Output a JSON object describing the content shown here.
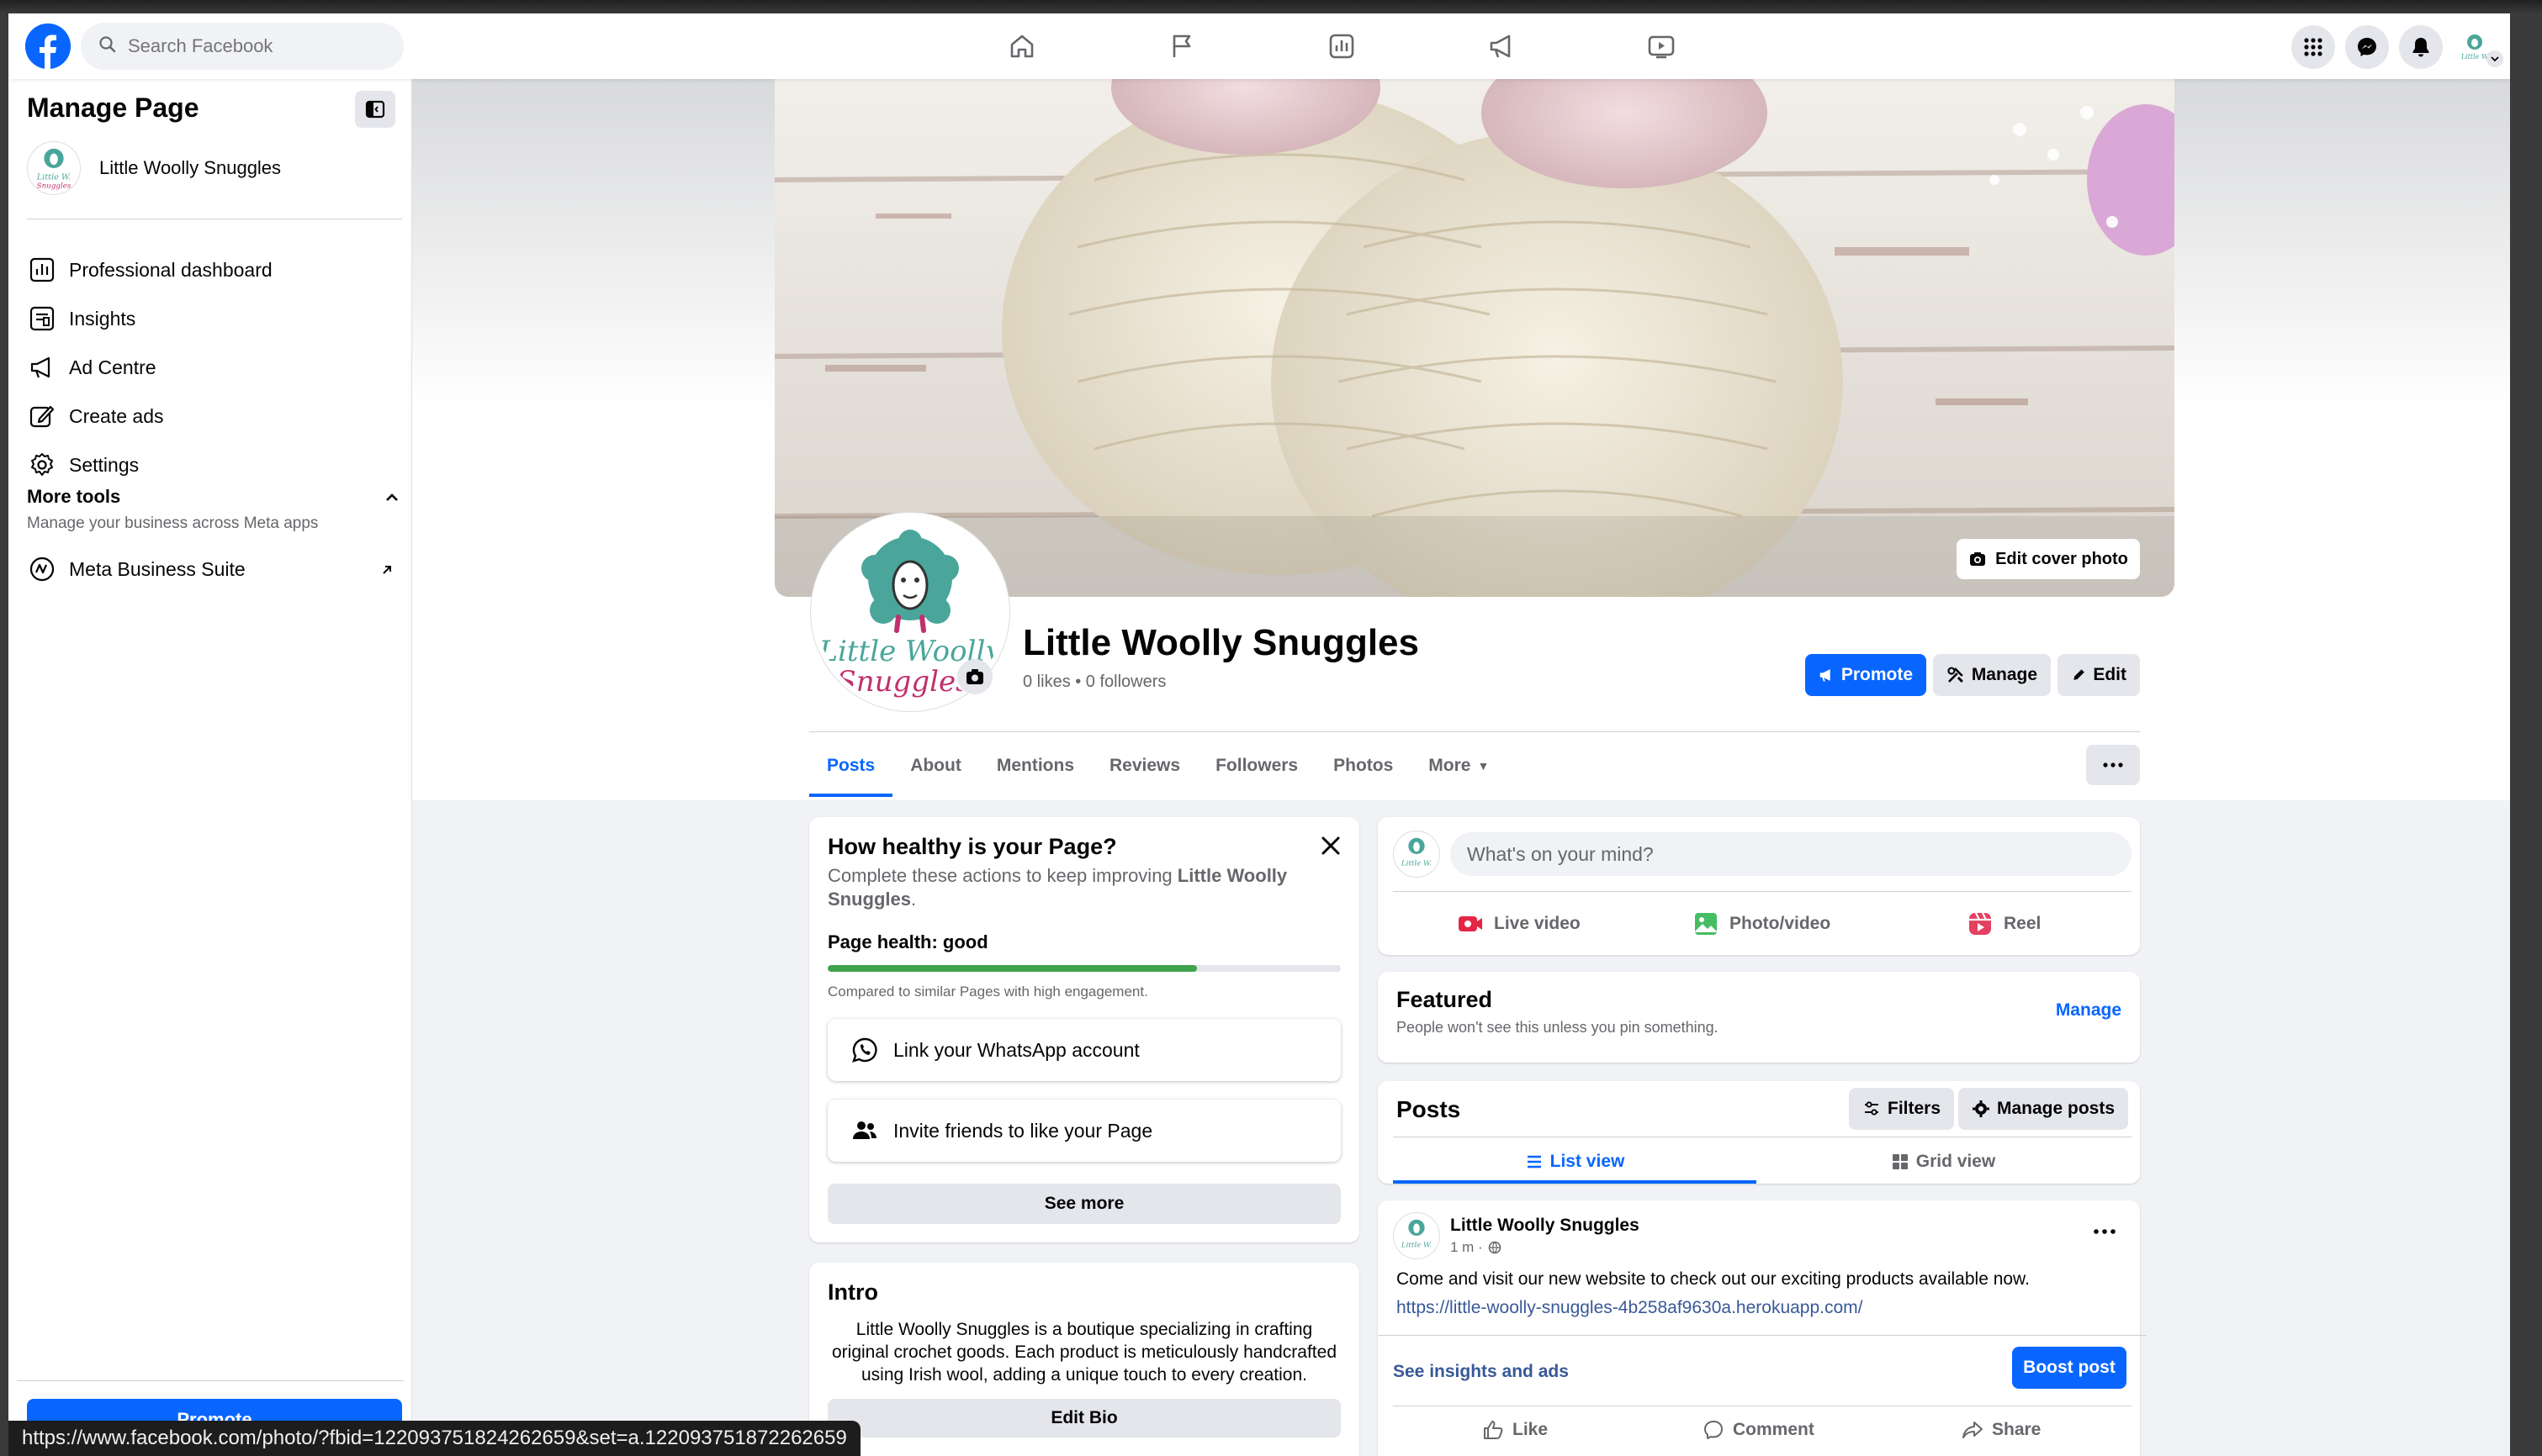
{
  "header": {
    "search_placeholder": "Search Facebook",
    "nav_icons": [
      "home-icon",
      "flag-icon",
      "insights-icon",
      "megaphone-icon",
      "video-icon"
    ]
  },
  "sidebar": {
    "title": "Manage Page",
    "page_name": "Little Woolly Snuggles",
    "items": [
      {
        "label": "Professional dashboard",
        "icon": "dashboard-icon"
      },
      {
        "label": "Insights",
        "icon": "insights-icon"
      },
      {
        "label": "Ad Centre",
        "icon": "megaphone-icon"
      },
      {
        "label": "Create ads",
        "icon": "edit-icon"
      },
      {
        "label": "Settings",
        "icon": "gear-icon"
      }
    ],
    "more_tools": {
      "title": "More tools",
      "subtitle": "Manage your business across Meta apps",
      "item": "Meta Business Suite"
    },
    "promote_label": "Promote"
  },
  "profile": {
    "edit_cover_label": "Edit cover photo",
    "page_title": "Little Woolly Snuggles",
    "stats": "0 likes • 0 followers",
    "logo_text_1": "Little Woolly",
    "logo_text_2": "Snuggles",
    "actions": {
      "promote": "Promote",
      "manage": "Manage",
      "edit": "Edit"
    },
    "tabs": [
      "Posts",
      "About",
      "Mentions",
      "Reviews",
      "Followers",
      "Photos",
      "More"
    ],
    "active_tab": "Posts"
  },
  "health": {
    "title": "How healthy is your Page?",
    "desc_prefix": "Complete these actions to keep improving ",
    "desc_bold": "Little Woolly Snuggles",
    "desc_suffix": ".",
    "status": "Page health: good",
    "progress": 0.72,
    "compare": "Compared to similar Pages with high engagement.",
    "task_whatsapp": "Link your WhatsApp account",
    "task_invite": "Invite friends to like your Page",
    "see_more": "See more"
  },
  "intro": {
    "title": "Intro",
    "bio": "Little Woolly Snuggles is a boutique specializing in crafting original crochet goods. Each product is meticulously handcrafted using Irish wool, adding a unique touch to every creation.",
    "edit_bio": "Edit Bio"
  },
  "composer": {
    "placeholder": "What's on your mind?",
    "live": "Live video",
    "photo": "Photo/video",
    "reel": "Reel"
  },
  "featured": {
    "title": "Featured",
    "subtitle": "People won't see this unless you pin something.",
    "manage": "Manage"
  },
  "posts": {
    "title": "Posts",
    "filters": "Filters",
    "manage_posts": "Manage posts",
    "list_view": "List view",
    "grid_view": "Grid view"
  },
  "post": {
    "author": "Little Woolly Snuggles",
    "time": "1 m ·",
    "text": "Come and visit our new website to check out our exciting products available now.",
    "link": "https://little-woolly-snuggles-4b258af9630a.herokuapp.com/",
    "insights": "See insights and ads",
    "boost": "Boost post",
    "like": "Like",
    "comment": "Comment",
    "share": "Share"
  },
  "status_url": "https://www.facebook.com/photo/?fbid=122093751824262659&set=a.122093751872262659",
  "colors": {
    "accent": "#0866ff",
    "health_green": "#3fa34d",
    "link": "#385898"
  }
}
